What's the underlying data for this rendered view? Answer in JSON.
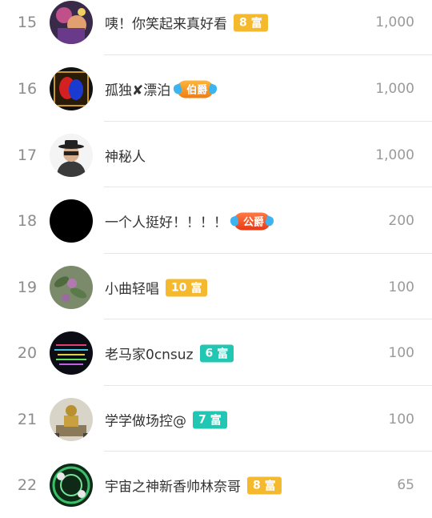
{
  "leaderboard": {
    "rows": [
      {
        "rank": "15",
        "name": "咦！你笑起来真好看",
        "badge": {
          "type": "rich",
          "num": "8",
          "label": "富",
          "color": "#f5b92e"
        },
        "score": "1,000",
        "avatar": "avatar-performer"
      },
      {
        "rank": "16",
        "name": "孤独✘漂泊",
        "badge": {
          "type": "title",
          "label": "伯爵"
        },
        "score": "1,000",
        "avatar": "avatar-red-blue"
      },
      {
        "rank": "17",
        "name": "神秘人",
        "badge": null,
        "score": "1,000",
        "avatar": "avatar-mystery-man"
      },
      {
        "rank": "18",
        "name": "一个人挺好！！！！",
        "badge": {
          "type": "title",
          "label": "公爵"
        },
        "score": "200",
        "avatar": "avatar-black"
      },
      {
        "rank": "19",
        "name": "小曲轻唱",
        "badge": {
          "type": "rich",
          "num": "10",
          "label": "富",
          "color": "#f5b92e"
        },
        "score": "100",
        "avatar": "avatar-flowers"
      },
      {
        "rank": "20",
        "name": "老马家0cnsuz",
        "badge": {
          "type": "rich",
          "num": "6",
          "label": "富",
          "color": "#21c7b3"
        },
        "score": "100",
        "avatar": "avatar-dark-text"
      },
      {
        "rank": "21",
        "name": "学学做场控@",
        "badge": {
          "type": "rich",
          "num": "7",
          "label": "富",
          "color": "#21c7b3"
        },
        "score": "100",
        "avatar": "avatar-statue"
      },
      {
        "rank": "22",
        "name": "宇宙之神新香帅林奈哥",
        "badge": {
          "type": "rich",
          "num": "8",
          "label": "富",
          "color": "#f5b92e"
        },
        "score": "65",
        "avatar": "avatar-green-circles"
      }
    ]
  }
}
